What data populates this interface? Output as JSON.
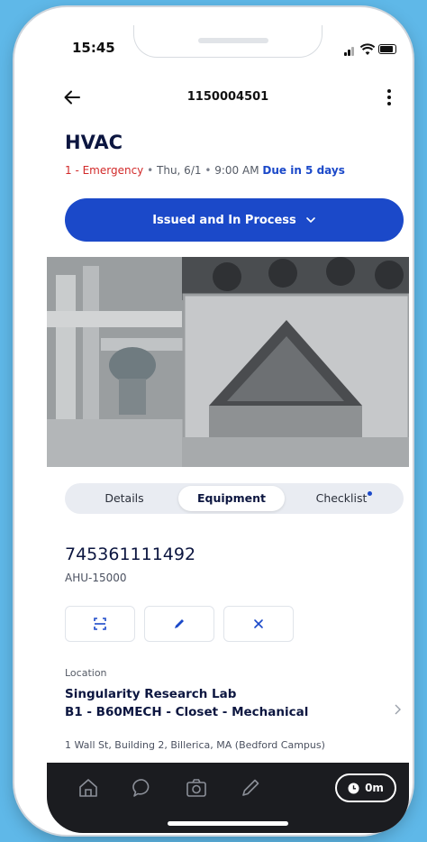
{
  "status_bar": {
    "time": "15:45"
  },
  "header": {
    "work_order_number": "1150004501"
  },
  "work_order": {
    "title": "HVAC",
    "priority": "1 - Emergency",
    "separator": "•",
    "date": "Thu, 6/1",
    "time": "9:00 AM",
    "due": "Due in 5 days",
    "status_label": "Issued and In Process"
  },
  "tabs": [
    {
      "label": "Details"
    },
    {
      "label": "Equipment",
      "selected": true
    },
    {
      "label": "Checklist",
      "has_indicator": true
    }
  ],
  "equipment": {
    "id": "745361111492",
    "tag": "AHU-15000",
    "actions": [
      "scan-icon",
      "edit-pencil-icon",
      "remove-x-icon"
    ]
  },
  "location": {
    "label": "Location",
    "site": "Singularity Research Lab",
    "room": "B1 - B60MECH - Closet - Mechanical",
    "address": "1 Wall St, Building 2, Billerica, MA (Bedford Campus)"
  },
  "bottom_nav": {
    "icons": [
      "home-icon",
      "chat-icon",
      "camera-icon",
      "pencil-icon"
    ],
    "timer_label": "0m"
  },
  "colors": {
    "brand_blue": "#1b49c9",
    "emergency_red": "#d22a2a",
    "title_navy": "#0c1640",
    "bottom_bar": "#1b1c20"
  }
}
